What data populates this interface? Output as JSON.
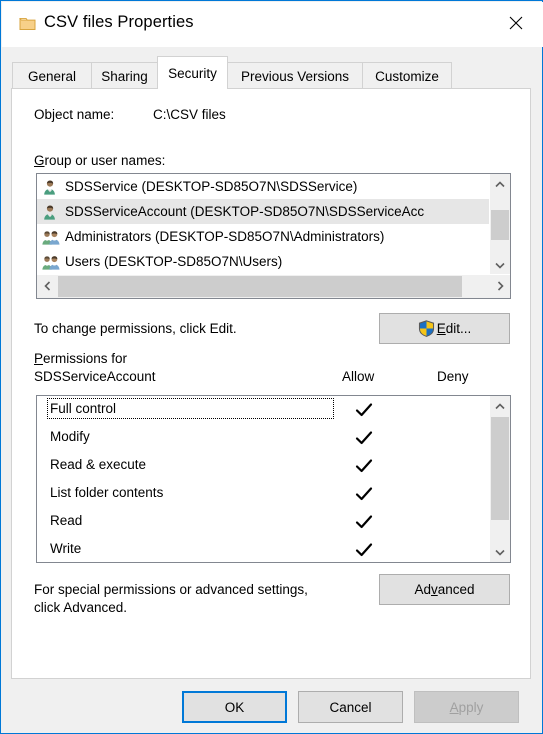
{
  "window": {
    "title": "CSV files Properties",
    "icon": "folder-icon",
    "close_label": "✕"
  },
  "tabs": [
    {
      "label": "General",
      "active": false
    },
    {
      "label": "Sharing",
      "active": false
    },
    {
      "label": "Security",
      "active": true
    },
    {
      "label": "Previous Versions",
      "active": false
    },
    {
      "label": "Customize",
      "active": false
    }
  ],
  "security": {
    "object_name_label": "Object name:",
    "object_name_value": "C:\\CSV files",
    "group_label_accel": "G",
    "group_label_rest": "roup or user names:",
    "group_users": [
      {
        "name": "SDSService (DESKTOP-SD85O7N\\SDSService)",
        "icon": "user-icon",
        "selected": false
      },
      {
        "name": "SDSServiceAccount (DESKTOP-SD85O7N\\SDSServiceAcc",
        "icon": "user-icon",
        "selected": true
      },
      {
        "name": "Administrators (DESKTOP-SD85O7N\\Administrators)",
        "icon": "group-icon",
        "selected": false
      },
      {
        "name": "Users (DESKTOP-SD85O7N\\Users)",
        "icon": "group-icon",
        "selected": false
      }
    ],
    "change_hint": "To change permissions, click Edit.",
    "edit_button_accel": "E",
    "edit_button_pre": "",
    "edit_button_rest": "dit...",
    "permissions_label_accel": "P",
    "permissions_label_rest": "ermissions for",
    "permissions_subject": "SDSServiceAccount",
    "allow_header": "Allow",
    "deny_header": "Deny",
    "permissions": [
      {
        "name": "Full control",
        "allow": true,
        "deny": false,
        "focused": true
      },
      {
        "name": "Modify",
        "allow": true,
        "deny": false,
        "focused": false
      },
      {
        "name": "Read & execute",
        "allow": true,
        "deny": false,
        "focused": false
      },
      {
        "name": "List folder contents",
        "allow": true,
        "deny": false,
        "focused": false
      },
      {
        "name": "Read",
        "allow": true,
        "deny": false,
        "focused": false
      },
      {
        "name": "Write",
        "allow": true,
        "deny": false,
        "focused": false
      }
    ],
    "advanced_hint_line1": "For special permissions or advanced settings,",
    "advanced_hint_line2": "click Advanced.",
    "advanced_button_pre": "Ad",
    "advanced_button_accel": "v",
    "advanced_button_rest": "anced"
  },
  "footer": {
    "ok_label": "OK",
    "cancel_label": "Cancel",
    "apply_accel": "A",
    "apply_rest": "pply",
    "apply_disabled": true
  },
  "colors": {
    "accent": "#0078d7",
    "dialog_bg": "#f0f0f0",
    "panel_bg": "#ffffff",
    "button_bg": "#e1e1e1",
    "selection_bg": "#e6e6e6",
    "scroll_thumb": "#cdcdcd",
    "disabled_text": "#a0a0a0"
  }
}
